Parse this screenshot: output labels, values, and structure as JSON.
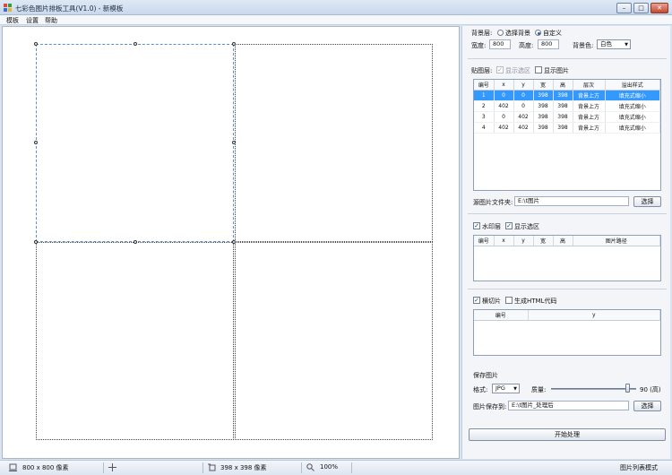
{
  "window": {
    "title": "七彩色图片排板工具(V1.0) - 新模板"
  },
  "menu": [
    "模板",
    "设置",
    "帮助"
  ],
  "background": {
    "section_label": "背景层:",
    "option_select": "选择背景",
    "option_custom": "自定义",
    "width_label": "宽度:",
    "width_value": "800",
    "height_label": "高度:",
    "height_value": "800",
    "color_label": "背景色:",
    "color_value": "白色"
  },
  "paste_layer": {
    "section_label": "贴图层:",
    "show_selection": "显示选区",
    "show_image": "显示图片",
    "columns": [
      "编号",
      "x",
      "y",
      "宽",
      "高",
      "层次",
      "溢出样式"
    ],
    "rows": [
      [
        "1",
        "0",
        "0",
        "398",
        "398",
        "背景上方",
        "填充式缩小"
      ],
      [
        "2",
        "402",
        "0",
        "398",
        "398",
        "背景上方",
        "填充式缩小"
      ],
      [
        "3",
        "0",
        "402",
        "398",
        "398",
        "背景上方",
        "填充式缩小"
      ],
      [
        "4",
        "402",
        "402",
        "398",
        "398",
        "背景上方",
        "填充式缩小"
      ]
    ],
    "selected_row": 0,
    "source_folder_label": "源图片文件夹:",
    "source_folder_value": "E:\\t图片",
    "select_button": "选择"
  },
  "watermark": {
    "watermark_layer": "水印层",
    "show_selection": "显示选区",
    "columns": [
      "编号",
      "x",
      "y",
      "宽",
      "高",
      "图片路径"
    ]
  },
  "slicing": {
    "slice_image": "横切片",
    "gen_html": "生成HTML代码",
    "columns": [
      "编号",
      "y"
    ]
  },
  "save": {
    "section_label": "保存图片",
    "format_label": "格式:",
    "format_value": "JPG",
    "quality_label": "质量:",
    "quality_value": "90 (高)",
    "quality": 90,
    "save_to_label": "图片保存到:",
    "save_to_value": "E:\\t图片_处理后",
    "select_button": "选择",
    "start_button": "开始处理"
  },
  "status": {
    "canvas_size": "800 x 800 像素",
    "tile_size": "398 x 398 像素",
    "zoom": "100%",
    "mode": "图片列表模式"
  }
}
